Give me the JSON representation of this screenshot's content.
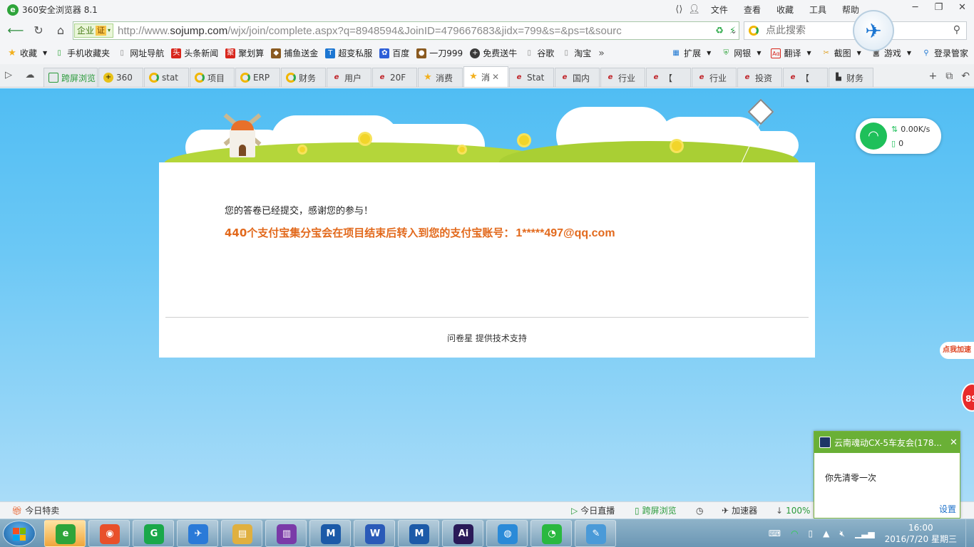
{
  "window": {
    "title": "360安全浏览器 8.1",
    "menus": [
      "文件",
      "查看",
      "收藏",
      "工具",
      "帮助"
    ]
  },
  "address_bar": {
    "enterprise_label": "企业",
    "cert_label": "证",
    "url_prefix": "http://www.",
    "url_domain": "sojump.com",
    "url_rest": "/wjx/join/complete.aspx?q=8948594&JoinID=479667683&jidx=799&s=&ps=t&sourc",
    "search_placeholder": "点此搜索"
  },
  "bookmarks": {
    "left": [
      {
        "label": "收藏",
        "icon": "star-icon",
        "color": "#f2b01e"
      },
      {
        "label": "手机收藏夹",
        "icon": "phone-icon",
        "color": "#2ea43a"
      },
      {
        "label": "网址导航",
        "icon": "page-icon",
        "color": "#8a8a8a"
      },
      {
        "label": "头条新闻",
        "icon": "news-icon",
        "color": "#d8261c"
      },
      {
        "label": "聚划算",
        "icon": "juhuasuan-icon",
        "color": "#d8261c"
      },
      {
        "label": "捕鱼送金",
        "icon": "fish-icon",
        "color": "#8a5a20"
      },
      {
        "label": "超变私服",
        "icon": "t-icon",
        "color": "#1c76d2"
      },
      {
        "label": "百度",
        "icon": "baidu-icon",
        "color": "#2e5fd8"
      },
      {
        "label": "一刀999",
        "icon": "game-icon",
        "color": "#8a5a20"
      },
      {
        "label": "免费送牛",
        "icon": "plus-icon",
        "color": "#3a3a3a"
      },
      {
        "label": "谷歌",
        "icon": "page-icon",
        "color": "#8a8a8a"
      },
      {
        "label": "淘宝",
        "icon": "page-icon",
        "color": "#8a8a8a"
      }
    ],
    "more": "»",
    "right": [
      {
        "label": "扩展",
        "icon": "grid-icon",
        "color": "#1c76d2"
      },
      {
        "label": "网银",
        "icon": "shield-icon",
        "color": "#2ea43a"
      },
      {
        "label": "翻译",
        "icon": "translate-icon",
        "color": "#d8261c"
      },
      {
        "label": "截图",
        "icon": "scissors-icon",
        "color": "#e0a020"
      },
      {
        "label": "游戏",
        "icon": "gamepad-icon",
        "color": "#666666"
      },
      {
        "label": "登录管家",
        "icon": "key-icon",
        "color": "#1c76d2"
      }
    ]
  },
  "tabs": {
    "fullscreen": "跨屏浏览",
    "items": [
      {
        "label": "360",
        "icon": "360-icon"
      },
      {
        "label": "stat",
        "icon": "search-o-icon"
      },
      {
        "label": "项目",
        "icon": "search-o-icon"
      },
      {
        "label": "ERP",
        "icon": "search-o-icon"
      },
      {
        "label": "财务",
        "icon": "search-o-icon"
      },
      {
        "label": "用户",
        "icon": "e-icon"
      },
      {
        "label": "20F",
        "icon": "e-icon"
      },
      {
        "label": "消费",
        "icon": "star-icon"
      },
      {
        "label": "消",
        "icon": "star-icon",
        "active": true
      },
      {
        "label": "Stat",
        "icon": "e-icon"
      },
      {
        "label": "国内",
        "icon": "e-icon"
      },
      {
        "label": "行业",
        "icon": "e-icon"
      },
      {
        "label": "【",
        "icon": "e-icon"
      },
      {
        "label": "行业",
        "icon": "e-icon"
      },
      {
        "label": "投资",
        "icon": "e-icon"
      },
      {
        "label": "【",
        "icon": "e-icon"
      },
      {
        "label": "财务",
        "icon": "printer-icon"
      }
    ]
  },
  "page": {
    "message": "您的答卷已经提交，感谢您的参与！",
    "reward": "440个支付宝集分宝会在项目结束后转入到您的支付宝账号：",
    "account": "1*****497@qq.com",
    "support": "问卷星 提供技术支持"
  },
  "speed_widget": {
    "rate": "0.00K/s",
    "count": "0"
  },
  "accelerate": {
    "badge": "点我加速",
    "value": "89"
  },
  "statusbar": {
    "left": "今日特卖",
    "live": "今日直播",
    "fullscreen": "跨屏浏览",
    "accelerator": "加速器",
    "percent": "100%"
  },
  "notification": {
    "group": "云南魂动CX-5车友会(178...",
    "message": "你先清零一次",
    "settings": "设置"
  },
  "taskbar": {
    "time": "16:00",
    "date": "2016/7/20 星期三",
    "apps": [
      {
        "name": "360-browser-icon",
        "color": "#2ea43a",
        "glyph": "e",
        "active": true
      },
      {
        "name": "chrome-icon",
        "color": "#e8502a",
        "glyph": "◉"
      },
      {
        "name": "app-green-icon",
        "color": "#1aa84a",
        "glyph": "G"
      },
      {
        "name": "bird-app-icon",
        "color": "#2a7ad8",
        "glyph": "✈"
      },
      {
        "name": "file-explorer-icon",
        "color": "#e0b040",
        "glyph": "▤"
      },
      {
        "name": "winrar-icon",
        "color": "#7a3aa8",
        "glyph": "▥"
      },
      {
        "name": "app-m-icon",
        "color": "#1c5aa8",
        "glyph": "M"
      },
      {
        "name": "word-icon",
        "color": "#2a5ab8",
        "glyph": "W"
      },
      {
        "name": "app-m2-icon",
        "color": "#1c5aa8",
        "glyph": "M"
      },
      {
        "name": "illustrator-icon",
        "color": "#2a1a58",
        "glyph": "Ai"
      },
      {
        "name": "network-globe-icon",
        "color": "#2a8ad8",
        "glyph": "◍"
      },
      {
        "name": "wechat-icon",
        "color": "#2ab840",
        "glyph": "◔"
      },
      {
        "name": "paint-icon",
        "color": "#4a9ad8",
        "glyph": "✎"
      }
    ]
  }
}
